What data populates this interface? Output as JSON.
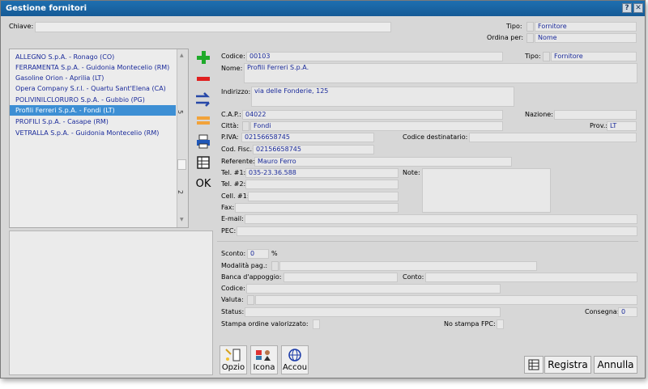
{
  "window": {
    "title": "Gestione fornitori",
    "help_label": "?",
    "close_label": "✕"
  },
  "search": {
    "chiave_label": "Chiave:",
    "chiave_value": "",
    "tipo_label": "Tipo:",
    "tipo_value": "Fornitore",
    "ordina_label": "Ordina per:",
    "ordina_value": "Nome"
  },
  "list": {
    "items": [
      "ALLEGNO S.p.A. - Ronago (CO)",
      "FERRAMENTA S.p.A. - Guidonia Montecelio (RM)",
      "Gasoline Orion - Aprilia (LT)",
      "Opera Company S.r.l. - Quartu Sant'Elena (CA)",
      "POLIVINILCLORURO S.p.A. - Gubbio (PG)",
      "Profili Ferreri S.p.A. - Fondi (LT)",
      "PROFILI S.p.A. - Casape (RM)",
      "VETRALLA S.p.A. - Guidonia Montecelio (RM)"
    ],
    "selected_index": 5,
    "scroll_top_label": "5",
    "scroll_bottom_label": "2"
  },
  "tools": {
    "ok_label": "OK"
  },
  "form": {
    "codice_label": "Codice:",
    "codice_value": "00103",
    "tipo_label": "Tipo:",
    "tipo_value": "Fornitore",
    "nome_label": "Nome:",
    "nome_value": "Profili Ferreri S.p.A.",
    "indirizzo_label": "Indirizzo:",
    "indirizzo_value": "via delle Fonderie, 125",
    "cap_label": "C.A.P.:",
    "cap_value": "04022",
    "nazione_label": "Nazione:",
    "nazione_value": "",
    "citta_label": "Città:",
    "citta_value": "Fondi",
    "prov_label": "Prov.:",
    "prov_value": "LT",
    "piva_label": "P.IVA:",
    "piva_value": "02156658745",
    "codice_dest_label": "Codice destinatario:",
    "codice_dest_value": "",
    "cod_fisc_label": "Cod. Fisc.:",
    "cod_fisc_value": "02156658745",
    "referente_label": "Referente:",
    "referente_value": "Mauro Ferro",
    "tel1_label": "Tel. #1:",
    "tel1_value": "035-23.36.588",
    "note_label": "Note:",
    "note_value": "",
    "tel2_label": "Tel. #2:",
    "tel2_value": "",
    "cell1_label": "Cell. #1:",
    "cell1_value": "",
    "fax_label": "Fax:",
    "fax_value": "",
    "email_label": "E-mail:",
    "email_value": "",
    "pec_label": "PEC:",
    "pec_value": "",
    "sconto_label": "Sconto:",
    "sconto_value": "0",
    "sconto_unit": "%",
    "modalita_label": "Modalità pag.:",
    "modalita_value": "",
    "banca_label": "Banca d'appoggio:",
    "banca_value": "",
    "conto_label": "Conto:",
    "conto_value": "",
    "codice2_label": "Codice:",
    "codice2_value": "",
    "valuta_label": "Valuta:",
    "valuta_value": "",
    "status_label": "Status:",
    "status_value": "",
    "consegna_label": "Consegna:",
    "consegna_value": "0",
    "stampa_label": "Stampa ordine valorizzato:",
    "no_stampa_label": "No stampa FPC:"
  },
  "bottom": {
    "opzio_label": "Opzio",
    "icona_label": "Icona",
    "accou_label": "Accou",
    "registra_label": "Registra",
    "annulla_label": "Annulla"
  },
  "colors": {
    "accent": "#1e6fb0",
    "selection": "#3d8fd4",
    "value_text": "#1a2a9a",
    "add_green": "#1faa2a",
    "remove_red": "#e02020",
    "swap_blue": "#2748a8",
    "edit_orange": "#f2a33a"
  }
}
